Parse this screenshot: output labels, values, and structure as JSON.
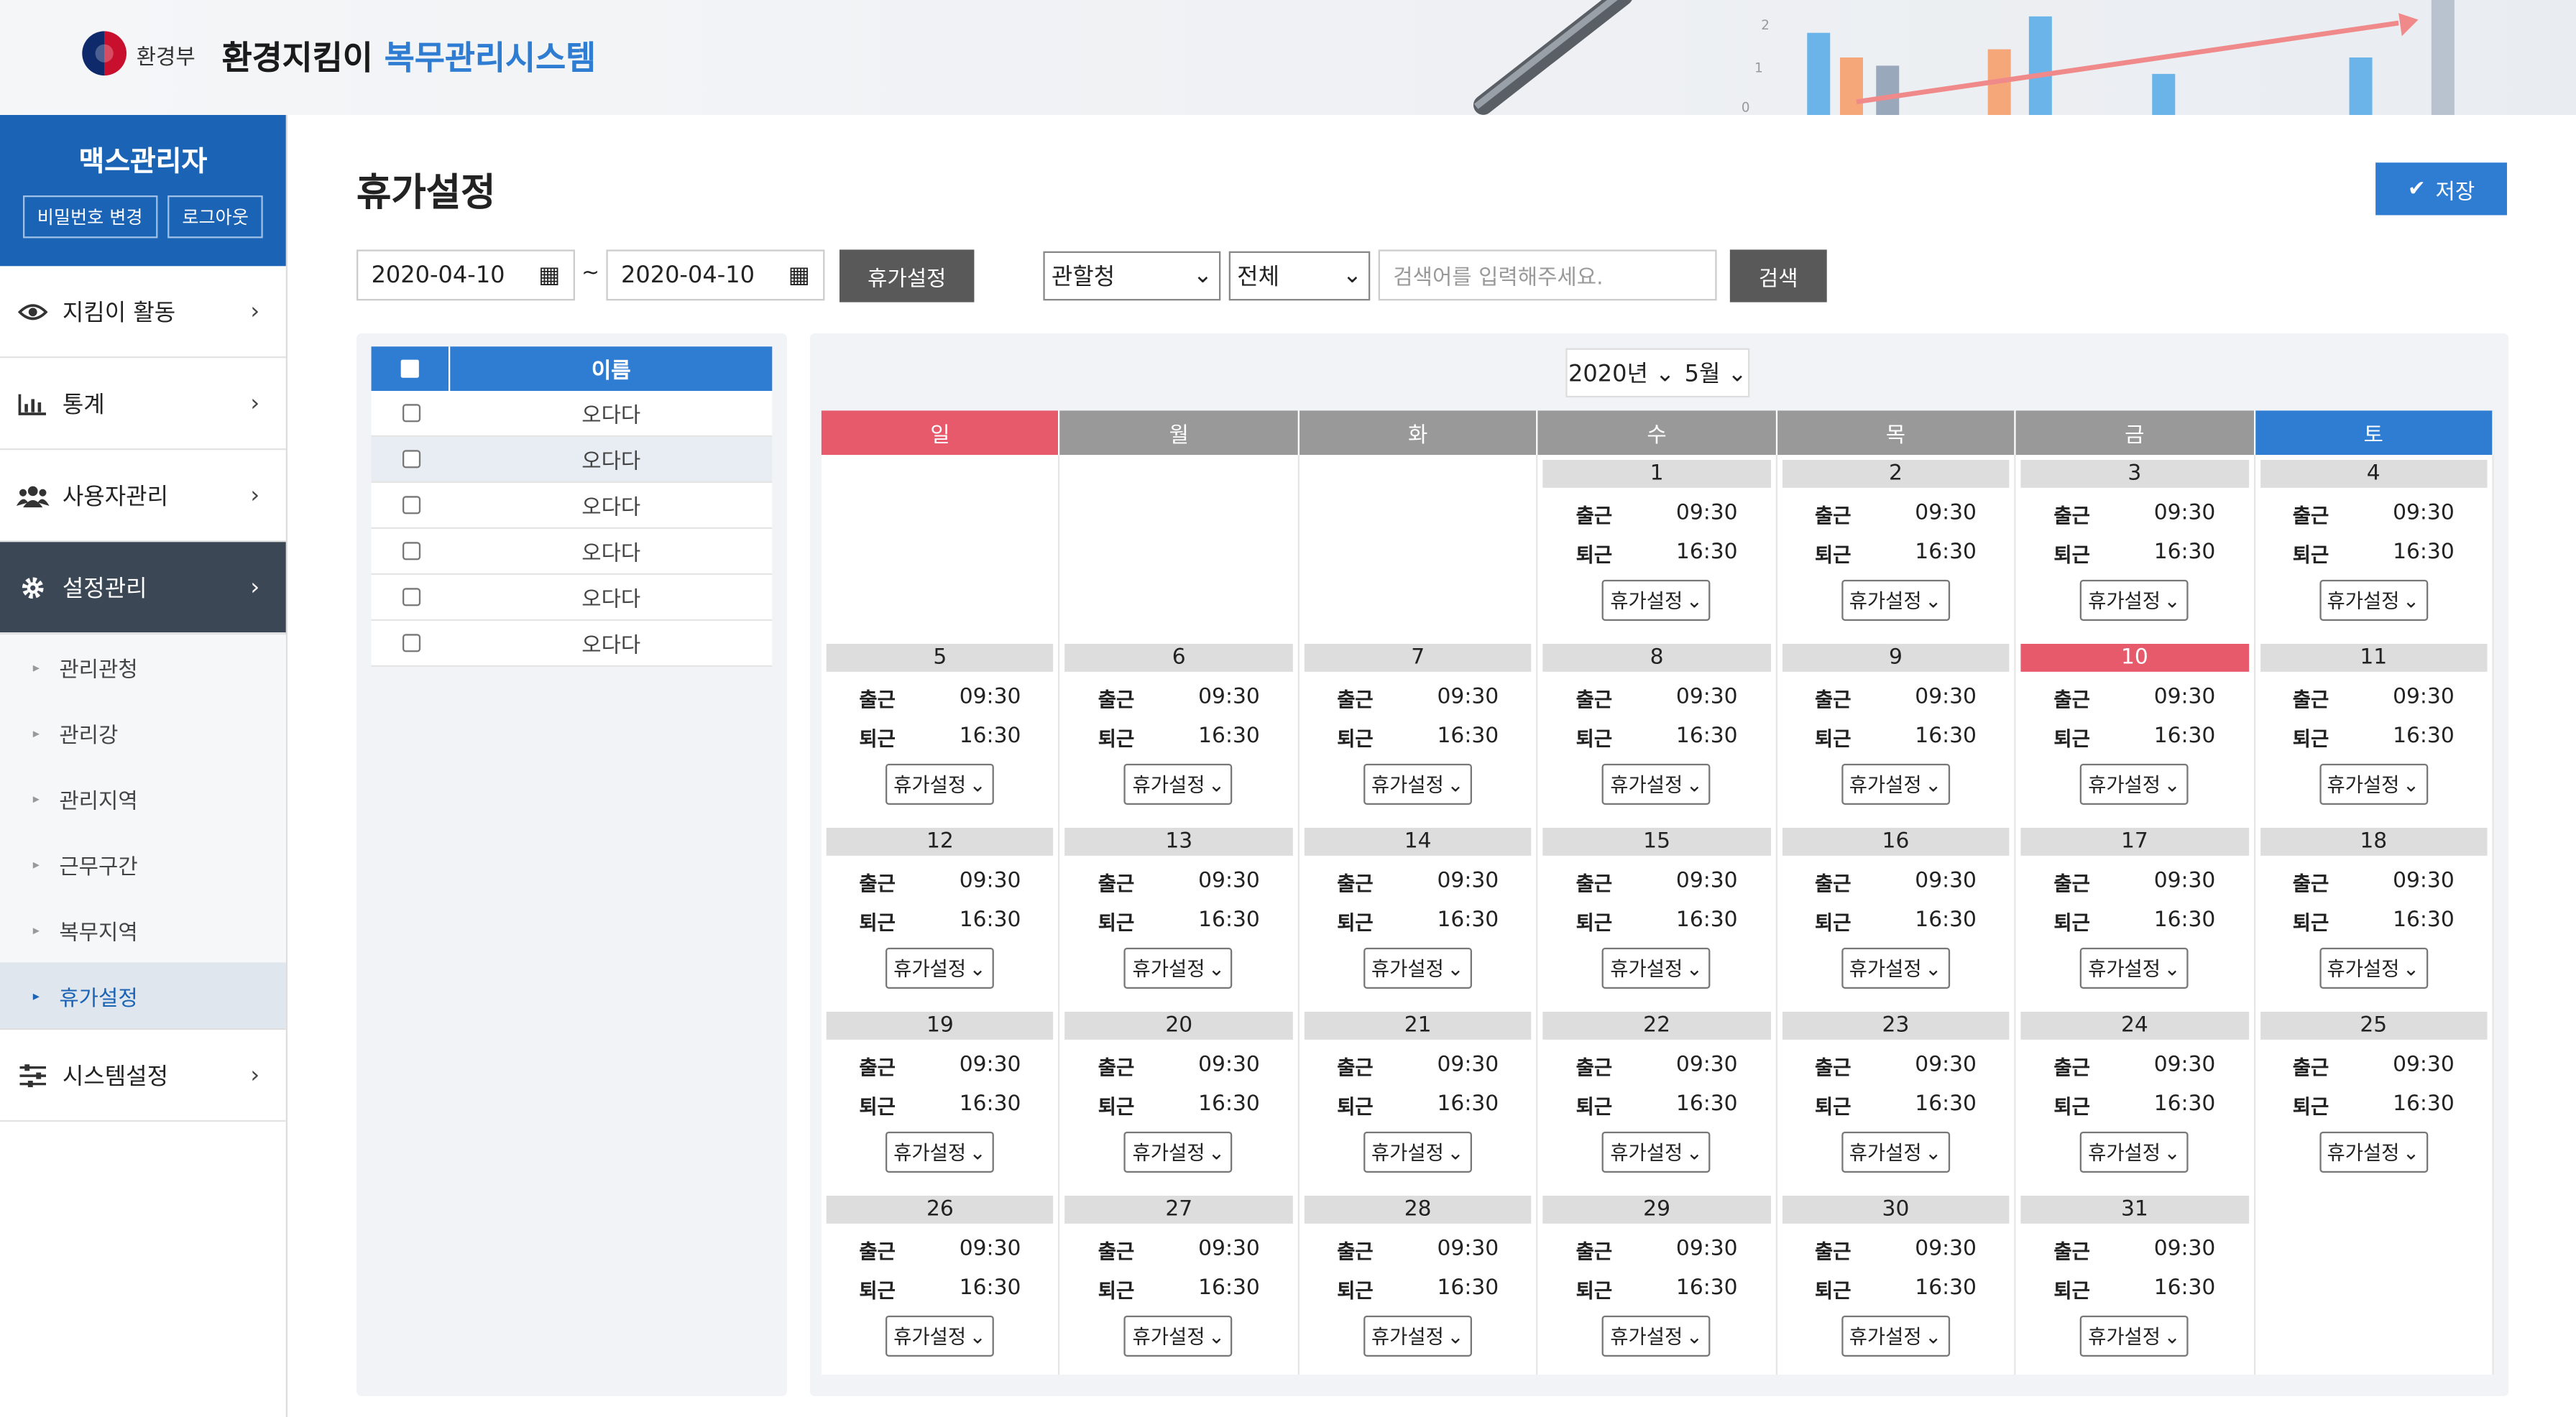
{
  "header": {
    "ministry": "환경부",
    "title_part1": "환경지킴이",
    "title_part2": "복무관리시스템"
  },
  "sidebar": {
    "user_name": "맥스관리자",
    "change_password": "비밀번호 변경",
    "logout": "로그아웃",
    "menu": [
      {
        "label": "지킴이 활동",
        "icon": "eye-icon"
      },
      {
        "label": "통계",
        "icon": "bar-chart-icon"
      },
      {
        "label": "사용자관리",
        "icon": "users-icon"
      },
      {
        "label": "설정관리",
        "icon": "gear-icon"
      }
    ],
    "submenu": [
      "관리관청",
      "관리강",
      "관리지역",
      "근무구간",
      "복무지역",
      "휴가설정"
    ],
    "active_sub": "휴가설정",
    "system_menu": {
      "label": "시스템설정",
      "icon": "sliders-icon"
    }
  },
  "page": {
    "title": "휴가설정",
    "save": "저장"
  },
  "toolbar": {
    "date_from": "2020-04-10",
    "tilde": "~",
    "date_to": "2020-04-10",
    "vacation_btn": "휴가설정",
    "select1": "관할청",
    "select2": "전체",
    "search_placeholder": "검색어를 입력해주세요.",
    "search_btn": "검색"
  },
  "list": {
    "header": "이름",
    "rows": [
      "오다다",
      "오다다",
      "오다다",
      "오다다",
      "오다다",
      "오다다"
    ]
  },
  "calendar": {
    "year": "2020년",
    "month": "5월",
    "weekdays": [
      "일",
      "월",
      "화",
      "수",
      "목",
      "금",
      "토"
    ],
    "in_label": "출근",
    "out_label": "퇴근",
    "in_time": "09:30",
    "out_time": "16:30",
    "select_label": "휴가설정",
    "today": 10,
    "weeks": [
      [
        "",
        "",
        "",
        1,
        2,
        3,
        4
      ],
      [
        5,
        6,
        7,
        8,
        9,
        10,
        11
      ],
      [
        12,
        13,
        14,
        15,
        16,
        17,
        18
      ],
      [
        19,
        20,
        21,
        22,
        23,
        24,
        25
      ],
      [
        26,
        27,
        28,
        29,
        30,
        31,
        ""
      ]
    ]
  },
  "colors": {
    "primary": "#2f7dd3",
    "sunday": "#e65a6c",
    "sidebar_active": "#3b4754",
    "profile": "#1b63b4"
  }
}
